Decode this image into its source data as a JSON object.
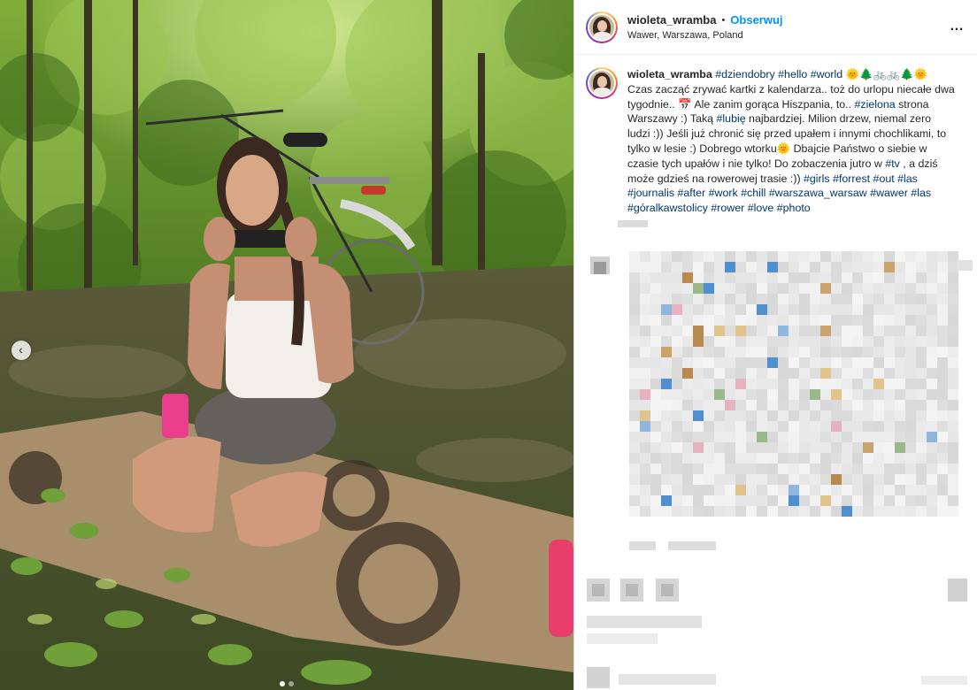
{
  "post": {
    "username": "wioleta_wramba",
    "separator": "•",
    "follow_label": "Obserwuj",
    "location": "Wawer, Warszawa, Poland",
    "more_icon": "…"
  },
  "caption": {
    "username": "wioleta_wramba",
    "segments": [
      {
        "t": "tag",
        "v": "#dziendobry"
      },
      {
        "t": "txt",
        "v": " "
      },
      {
        "t": "tag",
        "v": "#hello"
      },
      {
        "t": "txt",
        "v": " "
      },
      {
        "t": "tag",
        "v": "#world"
      },
      {
        "t": "txt",
        "v": " 🌞🌲🚲🚲🌲🌞"
      },
      {
        "t": "txt",
        "v": " Czas zacząć zrywać kartki z kalendarza.. toż do urlopu niecałe dwa tygodnie.. 📅 Ale zanim gorąca Hiszpania, to.. "
      },
      {
        "t": "tag",
        "v": "#zielona"
      },
      {
        "t": "txt",
        "v": " strona Warszawy :) Taką "
      },
      {
        "t": "tag",
        "v": "#lubię"
      },
      {
        "t": "txt",
        "v": " najbardziej. Milion drzew, niemal zero ludzi :)) Jeśli już chronić się przed upałem i innymi chochlikami, to tylko w lesie :) Dobrego wtorku🌞 Dbajcie Państwo o siebie w czasie tych upałów i nie tylko! Do zobaczenia jutro w "
      },
      {
        "t": "tag",
        "v": "#tv"
      },
      {
        "t": "txt",
        "v": " , a dziś może gdzieś na rowerowej trasie :)) "
      },
      {
        "t": "tag",
        "v": "#girls"
      },
      {
        "t": "txt",
        "v": " "
      },
      {
        "t": "tag",
        "v": "#forrest"
      },
      {
        "t": "txt",
        "v": " "
      },
      {
        "t": "tag",
        "v": "#out"
      },
      {
        "t": "txt",
        "v": " "
      },
      {
        "t": "tag",
        "v": "#las"
      },
      {
        "t": "txt",
        "v": " "
      },
      {
        "t": "tag",
        "v": "#journalis"
      },
      {
        "t": "txt",
        "v": " "
      },
      {
        "t": "tag",
        "v": "#after"
      },
      {
        "t": "txt",
        "v": " "
      },
      {
        "t": "tag",
        "v": "#work"
      },
      {
        "t": "txt",
        "v": " "
      },
      {
        "t": "tag",
        "v": "#chill"
      },
      {
        "t": "txt",
        "v": " "
      },
      {
        "t": "tag",
        "v": "#warszawa_warsaw"
      },
      {
        "t": "txt",
        "v": " "
      },
      {
        "t": "tag",
        "v": "#wawer"
      },
      {
        "t": "txt",
        "v": " "
      },
      {
        "t": "tag",
        "v": "#las"
      },
      {
        "t": "txt",
        "v": " "
      },
      {
        "t": "tag",
        "v": "#góralkawstolicy"
      },
      {
        "t": "txt",
        "v": " "
      },
      {
        "t": "tag",
        "v": "#rower"
      },
      {
        "t": "txt",
        "v": " "
      },
      {
        "t": "tag",
        "v": "#love"
      },
      {
        "t": "txt",
        "v": " "
      },
      {
        "t": "tag",
        "v": "#photo"
      }
    ]
  },
  "carousel": {
    "prev_icon": "‹",
    "slide_count": 2,
    "active_slide": 1
  },
  "colors": {
    "follow": "#0095f6",
    "hashtag": "#00376b",
    "text": "#262626",
    "border": "#dbdbdb"
  }
}
